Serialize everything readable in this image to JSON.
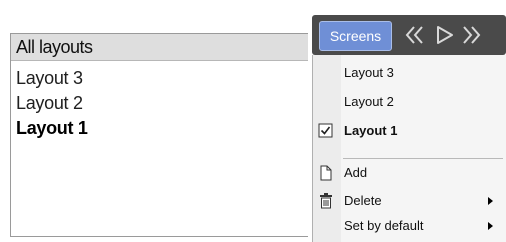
{
  "layouts_panel": {
    "header": "All layouts",
    "items": [
      {
        "label": "Layout 3"
      },
      {
        "label": "Layout 2"
      },
      {
        "label": "Layout 1"
      }
    ]
  },
  "toolbar": {
    "screens_label": "Screens",
    "icons": [
      "double-chevron-left-icon",
      "play-icon",
      "double-chevron-right-icon"
    ]
  },
  "menu": {
    "items": [
      {
        "label": "Layout 3",
        "checked": false
      },
      {
        "label": "Layout 2",
        "checked": false
      },
      {
        "label": "Layout 1",
        "checked": true
      },
      {
        "label": "Add",
        "icon": "new-page-icon"
      },
      {
        "label": "Delete",
        "icon": "trash-icon",
        "submenu": true
      },
      {
        "label": "Set by default",
        "submenu": true
      }
    ]
  },
  "colors": {
    "toolbar_bg": "#4a4a4a",
    "screens_button": "#6f8fd6",
    "panel_header": "#dedede",
    "menu_bg": "#f5f5f5"
  }
}
